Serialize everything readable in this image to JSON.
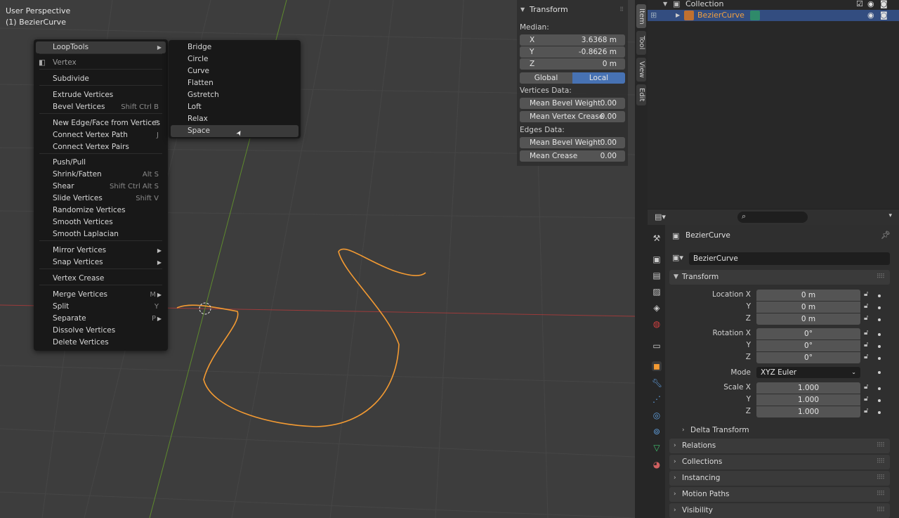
{
  "viewport": {
    "title": "User Perspective",
    "subtitle": "(1) BezierCurve"
  },
  "context_menu": {
    "items": [
      {
        "label": "LoopTools",
        "shortcut": "",
        "submenu": true
      },
      {
        "label": "Vertex",
        "shortcut": "",
        "header": true
      },
      {
        "label": "Subdivide",
        "shortcut": ""
      },
      {
        "label": "Extrude Vertices",
        "shortcut": ""
      },
      {
        "label": "Bevel Vertices",
        "shortcut": "Shift Ctrl B"
      },
      {
        "label": "New Edge/Face from Vertices",
        "shortcut": "F"
      },
      {
        "label": "Connect Vertex Path",
        "shortcut": "J"
      },
      {
        "label": "Connect Vertex Pairs",
        "shortcut": ""
      },
      {
        "label": "Push/Pull",
        "shortcut": ""
      },
      {
        "label": "Shrink/Fatten",
        "shortcut": "Alt S"
      },
      {
        "label": "Shear",
        "shortcut": "Shift Ctrl Alt S"
      },
      {
        "label": "Slide Vertices",
        "shortcut": "Shift V"
      },
      {
        "label": "Randomize Vertices",
        "shortcut": ""
      },
      {
        "label": "Smooth Vertices",
        "shortcut": ""
      },
      {
        "label": "Smooth Laplacian",
        "shortcut": ""
      },
      {
        "label": "Mirror Vertices",
        "shortcut": "",
        "submenu": true
      },
      {
        "label": "Snap Vertices",
        "shortcut": "",
        "submenu": true
      },
      {
        "label": "Vertex Crease",
        "shortcut": ""
      },
      {
        "label": "Merge Vertices",
        "shortcut": "M",
        "submenu": true
      },
      {
        "label": "Split",
        "shortcut": "Y"
      },
      {
        "label": "Separate",
        "shortcut": "P",
        "submenu": true
      },
      {
        "label": "Dissolve Vertices",
        "shortcut": ""
      },
      {
        "label": "Delete Vertices",
        "shortcut": ""
      }
    ]
  },
  "looptools_submenu": {
    "items": [
      "Bridge",
      "Circle",
      "Curve",
      "Flatten",
      "Gstretch",
      "Loft",
      "Relax",
      "Space"
    ],
    "highlighted": "Space"
  },
  "npanel": {
    "title": "Transform",
    "median_label": "Median:",
    "x_label": "X",
    "x_value": "3.6368 m",
    "y_label": "Y",
    "y_value": "-0.8626 m",
    "z_label": "Z",
    "z_value": "0 m",
    "global_label": "Global",
    "local_label": "Local",
    "vertices_data_label": "Vertices Data:",
    "mean_bevel_weight_label": "Mean Bevel Weight",
    "mean_bevel_weight_value": "0.00",
    "mean_vertex_crease_label": "Mean Vertex Crease",
    "mean_vertex_crease_value": "0.00",
    "edges_data_label": "Edges Data:",
    "edge_mean_bevel_weight_label": "Mean Bevel Weight",
    "edge_mean_bevel_weight_value": "0.00",
    "mean_crease_label": "Mean Crease",
    "mean_crease_value": "0.00"
  },
  "vtabs": [
    "Item",
    "Tool",
    "View",
    "Edit"
  ],
  "outliner": {
    "collection": "Collection",
    "object": "BezierCurve"
  },
  "properties": {
    "object_name": "BezierCurve",
    "datablock_name": "BezierCurve",
    "transform_title": "Transform",
    "location_x_label": "Location X",
    "location_x": "0 m",
    "location_y_label": "Y",
    "location_y": "0 m",
    "location_z_label": "Z",
    "location_z": "0 m",
    "rotation_x_label": "Rotation X",
    "rotation_x": "0°",
    "rotation_y_label": "Y",
    "rotation_y": "0°",
    "rotation_z_label": "Z",
    "rotation_z": "0°",
    "mode_label": "Mode",
    "mode_value": "XYZ Euler",
    "scale_x_label": "Scale X",
    "scale_x": "1.000",
    "scale_y_label": "Y",
    "scale_y": "1.000",
    "scale_z_label": "Z",
    "scale_z": "1.000",
    "delta_transform": "Delta Transform",
    "relations": "Relations",
    "collections": "Collections",
    "instancing": "Instancing",
    "motion_paths": "Motion Paths",
    "visibility": "Visibility"
  },
  "colors": {
    "accent_blue": "#4772b3",
    "curve_orange": "#f39a32",
    "selected_row": "#334d80"
  }
}
